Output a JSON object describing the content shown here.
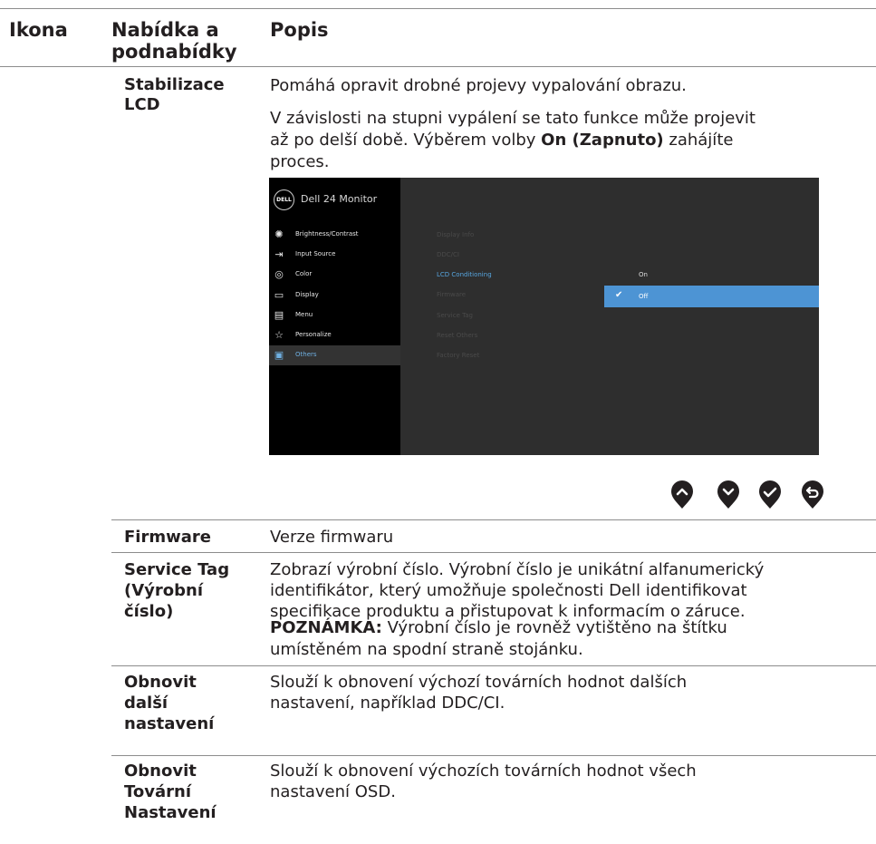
{
  "header": {
    "col_icon": "Ikona",
    "col_menu_line1": "Nabídka a",
    "col_menu_line2": "podnabídky",
    "col_desc": "Popis"
  },
  "rows": {
    "lcd": {
      "name_line1": "Stabilizace",
      "name_line2": "LCD",
      "desc1": "Pomáhá opravit drobné projevy vypalování obrazu.",
      "desc2_line1": "V závislosti na stupni vypálení se tato funkce může projevit",
      "desc2_line2_pre": "až po delší době. Výběrem volby ",
      "desc2_line2_bold": "On (Zapnuto)",
      "desc2_line2_post": " zahájíte",
      "desc2_line3": "proces."
    },
    "firmware": {
      "name": "Firmware",
      "desc": "Verze firmwaru"
    },
    "service_tag": {
      "name_line1": "Service Tag",
      "name_line2": "(Výrobní",
      "name_line3": "číslo)",
      "desc_line1": "Zobrazí výrobní číslo. Výrobní číslo je unikátní alfanumerický",
      "desc_line2": "identifikátor, který umožňuje společnosti Dell identifikovat",
      "desc_line3": "specifikace produktu a přistupovat k informacím o záruce.",
      "note_label": "POZNÁMKA:",
      "note_line1": " Výrobní číslo je rovněž vytištěno na štítku",
      "note_line2": "umístěném na spodní straně stojánku."
    },
    "reset_others": {
      "name_line1": "Obnovit",
      "name_line2": "další",
      "name_line3": "nastavení",
      "desc_line1": "Slouží k obnovení výchozí továrních hodnot dalších",
      "desc_line2": "nastavení, například DDC/CI."
    },
    "factory_reset": {
      "name_line1": "Obnovit",
      "name_line2": "Tovární",
      "name_line3": "Nastavení",
      "desc_line1": "Slouží k obnovení výchozích továrních hodnot všech",
      "desc_line2": "nastavení OSD."
    }
  },
  "osd": {
    "logo": "DELL",
    "model": "Dell 24 Monitor",
    "menu": [
      {
        "label": "Brightness/Contrast",
        "icon": "brightness-icon"
      },
      {
        "label": "Input Source",
        "icon": "input-source-icon"
      },
      {
        "label": "Color",
        "icon": "color-palette-icon"
      },
      {
        "label": "Display",
        "icon": "display-icon"
      },
      {
        "label": "Menu",
        "icon": "menu-icon"
      },
      {
        "label": "Personalize",
        "icon": "star-icon"
      },
      {
        "label": "Others",
        "icon": "others-icon"
      }
    ],
    "submenu": [
      "Display Info",
      "DDC/CI",
      "LCD Conditioning",
      "Firmware",
      "Service Tag",
      "Reset Others",
      "Factory Reset"
    ],
    "options": [
      "On",
      "Off"
    ],
    "selected_option": "Off",
    "active_menu": "Others",
    "active_submenu": "LCD Conditioning",
    "colors": {
      "background": "#2e2e2e",
      "sidebar": "#000000",
      "highlight": "#4d94d4",
      "active_text": "#57a6e0"
    }
  },
  "nav_buttons": [
    "up-icon",
    "down-icon",
    "check-icon",
    "back-icon"
  ]
}
